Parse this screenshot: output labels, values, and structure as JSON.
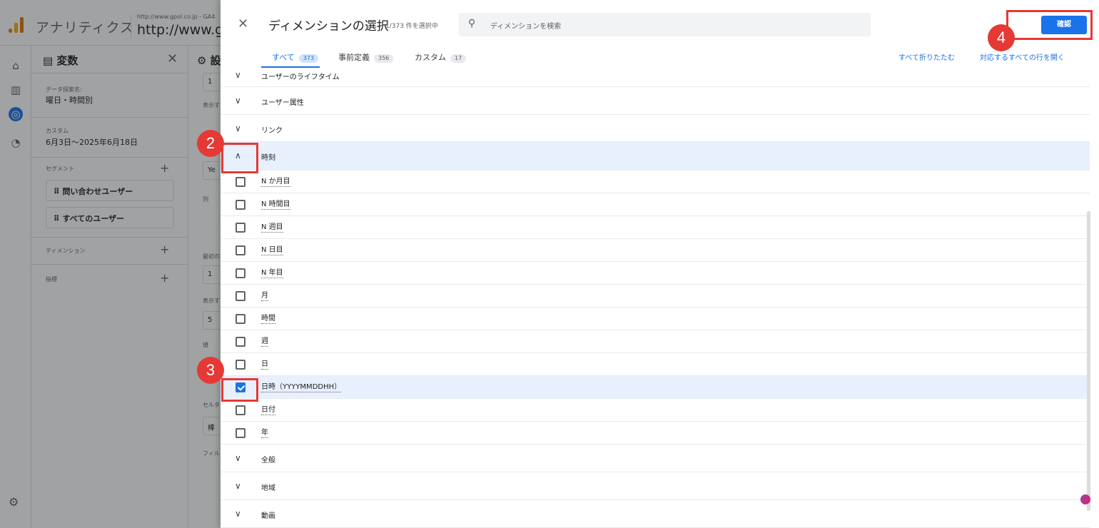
{
  "app": {
    "name": "アナリティクス",
    "account_small": "http://www.gpol.co.jp - GA4",
    "account_big": "http://www.gpol"
  },
  "rail": {
    "icons": [
      "home-icon",
      "reports-icon",
      "explore-icon",
      "advertising-icon"
    ],
    "settings_icon": "gear-icon"
  },
  "variables": {
    "title": "変数",
    "exploration_label": "データ探索名:",
    "exploration_name": "曜日・時間別",
    "date_label": "カスタム",
    "date_range": "6月3日〜2025年6月18日",
    "segments_label": "セグメント",
    "segments": [
      "問い合わせユーザー",
      "すべてのユーザー"
    ],
    "dimensions_label": "ディメンション",
    "metrics_label": "指標"
  },
  "settings_col": {
    "title": "設",
    "labels": [
      "表示す",
      "列",
      "最初の",
      "表示す",
      "値",
      "セルタ",
      "フィル"
    ],
    "values": [
      "1",
      "Ye",
      "1",
      "5",
      "棒"
    ]
  },
  "modal": {
    "title": "ディメンションの選択",
    "selected_count": "1/373 件を選択中",
    "search_placeholder": "ディメンションを検索",
    "confirm_label": "確認",
    "tabs": [
      {
        "label": "すべて",
        "count": "373",
        "active": true
      },
      {
        "label": "事前定義",
        "count": "356",
        "active": false
      },
      {
        "label": "カスタム",
        "count": "17",
        "active": false
      }
    ],
    "collapse_all": "すべて折りたたむ",
    "expand_matching": "対応するすべての行を開く",
    "categories_before": [
      "ユーザーのライフタイム",
      "ユーザー属性",
      "リンク"
    ],
    "expanded_category": "時刻",
    "time_items": [
      {
        "label": "N か月目",
        "checked": false
      },
      {
        "label": "N 時間目",
        "checked": false
      },
      {
        "label": "N 週目",
        "checked": false
      },
      {
        "label": "N 日目",
        "checked": false
      },
      {
        "label": "N 年目",
        "checked": false
      },
      {
        "label": "月",
        "checked": false
      },
      {
        "label": "時間",
        "checked": false
      },
      {
        "label": "週",
        "checked": false
      },
      {
        "label": "日",
        "checked": false
      },
      {
        "label": "日時（YYYYMMDDHH）",
        "checked": true
      },
      {
        "label": "日付",
        "checked": false
      },
      {
        "label": "年",
        "checked": false
      }
    ],
    "categories_after": [
      "全般",
      "地域",
      "動画"
    ]
  },
  "annotations": {
    "markers": [
      "2",
      "3",
      "4"
    ],
    "color": "#e53935"
  }
}
